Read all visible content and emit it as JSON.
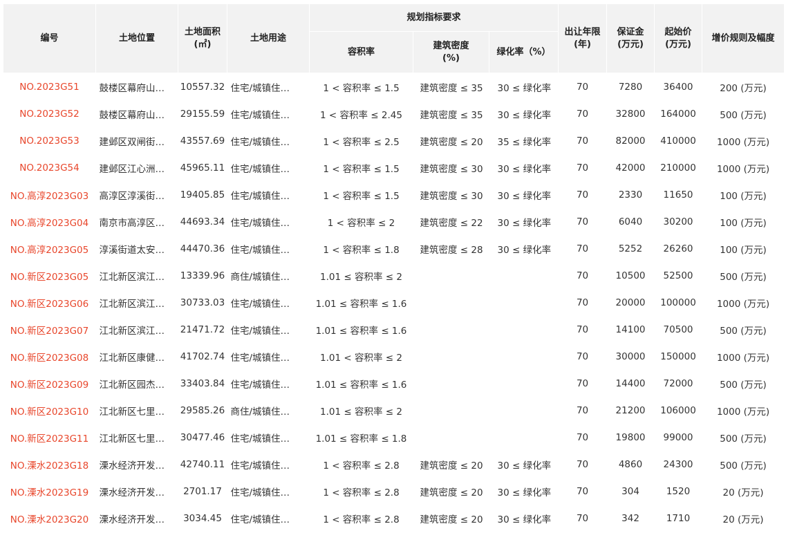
{
  "colors": {
    "code": "#e8462b",
    "header_bg": "#f2f2f2",
    "text": "#333333"
  },
  "headers": {
    "code": "编号",
    "location": "土地位置",
    "area": "土地面积\n(㎡)",
    "use": "土地用途",
    "planning": "规划指标要求",
    "far": "容积率",
    "density": "建筑密度\n(%)",
    "green": "绿化率（%）",
    "years": "出让年限\n(年)",
    "deposit": "保证金\n(万元)",
    "start": "起始价\n(万元)",
    "increment": "增价规则及幅度"
  },
  "rows": [
    {
      "code": "NO.2023G51",
      "location": "鼓楼区幕府山…",
      "area": "10557.32",
      "use": "住宅/城镇住…",
      "far": "1 < 容积率 ≤ 1.5",
      "density": "建筑密度 ≤ 35",
      "green": "30 ≤ 绿化率",
      "years": "70",
      "deposit": "7280",
      "start": "36400",
      "increment": "200 (万元)"
    },
    {
      "code": "NO.2023G52",
      "location": "鼓楼区幕府山…",
      "area": "29155.59",
      "use": "住宅/城镇住…",
      "far": "1 < 容积率 ≤ 2.45",
      "density": "建筑密度 ≤ 35",
      "green": "30 ≤ 绿化率",
      "years": "70",
      "deposit": "32800",
      "start": "164000",
      "increment": "500 (万元)"
    },
    {
      "code": "NO.2023G53",
      "location": "建邺区双闸街…",
      "area": "43557.69",
      "use": "住宅/城镇住…",
      "far": "1 < 容积率 ≤ 2.5",
      "density": "建筑密度 ≤ 20",
      "green": "35 ≤ 绿化率",
      "years": "70",
      "deposit": "82000",
      "start": "410000",
      "increment": "1000 (万元)"
    },
    {
      "code": "NO.2023G54",
      "location": "建邺区江心洲…",
      "area": "45965.11",
      "use": "住宅/城镇住…",
      "far": "1 < 容积率 ≤ 1.5",
      "density": "建筑密度 ≤ 30",
      "green": "30 ≤ 绿化率",
      "years": "70",
      "deposit": "42000",
      "start": "210000",
      "increment": "1000 (万元)"
    },
    {
      "code": "NO.高淳2023G03",
      "location": "高淳区淳溪街…",
      "area": "19405.85",
      "use": "住宅/城镇住…",
      "far": "1 < 容积率 ≤ 1.5",
      "density": "建筑密度 ≤ 30",
      "green": "30 ≤ 绿化率",
      "years": "70",
      "deposit": "2330",
      "start": "11650",
      "increment": "100 (万元)"
    },
    {
      "code": "NO.高淳2023G04",
      "location": "南京市高淳区…",
      "area": "44693.34",
      "use": "住宅/城镇住…",
      "far": "1 < 容积率 ≤ 2",
      "density": "建筑密度 ≤ 22",
      "green": "30 ≤ 绿化率",
      "years": "70",
      "deposit": "6040",
      "start": "30200",
      "increment": "100 (万元)"
    },
    {
      "code": "NO.高淳2023G05",
      "location": "淳溪街道太安…",
      "area": "44470.36",
      "use": "住宅/城镇住…",
      "far": "1 < 容积率 ≤ 1.8",
      "density": "建筑密度 ≤ 28",
      "green": "30 ≤ 绿化率",
      "years": "70",
      "deposit": "5252",
      "start": "26260",
      "increment": "100 (万元)"
    },
    {
      "code": "NO.新区2023G05",
      "location": "江北新区滨江…",
      "area": "13339.96",
      "use": "商住/城镇住…",
      "far": "1.01 ≤ 容积率 ≤ 2",
      "density": "",
      "green": "",
      "years": "70",
      "deposit": "10500",
      "start": "52500",
      "increment": "500 (万元)"
    },
    {
      "code": "NO.新区2023G06",
      "location": "江北新区滨江…",
      "area": "30733.03",
      "use": "住宅/城镇住…",
      "far": "1.01 ≤ 容积率 ≤ 1.6",
      "density": "",
      "green": "",
      "years": "70",
      "deposit": "20000",
      "start": "100000",
      "increment": "1000 (万元)"
    },
    {
      "code": "NO.新区2023G07",
      "location": "江北新区滨江…",
      "area": "21471.72",
      "use": "住宅/城镇住…",
      "far": "1.01 ≤ 容积率 ≤ 1.6",
      "density": "",
      "green": "",
      "years": "70",
      "deposit": "14100",
      "start": "70500",
      "increment": "500 (万元)"
    },
    {
      "code": "NO.新区2023G08",
      "location": "江北新区康健…",
      "area": "41702.74",
      "use": "住宅/城镇住…",
      "far": "1.01 < 容积率 ≤ 2",
      "density": "",
      "green": "",
      "years": "70",
      "deposit": "30000",
      "start": "150000",
      "increment": "1000 (万元)"
    },
    {
      "code": "NO.新区2023G09",
      "location": "江北新区园杰…",
      "area": "33403.84",
      "use": "住宅/城镇住…",
      "far": "1.01 ≤ 容积率 ≤ 1.6",
      "density": "",
      "green": "",
      "years": "70",
      "deposit": "14400",
      "start": "72000",
      "increment": "500 (万元)"
    },
    {
      "code": "NO.新区2023G10",
      "location": "江北新区七里…",
      "area": "29585.26",
      "use": "商住/城镇住…",
      "far": "1.01 ≤ 容积率 ≤ 2",
      "density": "",
      "green": "",
      "years": "70",
      "deposit": "21200",
      "start": "106000",
      "increment": "1000 (万元)"
    },
    {
      "code": "NO.新区2023G11",
      "location": "江北新区七里…",
      "area": "30477.46",
      "use": "住宅/城镇住…",
      "far": "1.01 ≤ 容积率 ≤ 1.8",
      "density": "",
      "green": "",
      "years": "70",
      "deposit": "19800",
      "start": "99000",
      "increment": "500 (万元)"
    },
    {
      "code": "NO.溧水2023G18",
      "location": "溧水经济开发…",
      "area": "42740.11",
      "use": "住宅/城镇住…",
      "far": "1 < 容积率 ≤ 2.8",
      "density": "建筑密度 ≤ 20",
      "green": "30 ≤ 绿化率",
      "years": "70",
      "deposit": "4860",
      "start": "24300",
      "increment": "500 (万元)"
    },
    {
      "code": "NO.溧水2023G19",
      "location": "溧水经济开发…",
      "area": "2701.17",
      "use": "住宅/城镇住…",
      "far": "1 < 容积率 ≤ 2.8",
      "density": "建筑密度 ≤ 20",
      "green": "30 ≤ 绿化率",
      "years": "70",
      "deposit": "304",
      "start": "1520",
      "increment": "20 (万元)"
    },
    {
      "code": "NO.溧水2023G20",
      "location": "溧水经济开发…",
      "area": "3034.45",
      "use": "住宅/城镇住…",
      "far": "1 < 容积率 ≤ 2.8",
      "density": "建筑密度 ≤ 20",
      "green": "30 ≤ 绿化率",
      "years": "70",
      "deposit": "342",
      "start": "1710",
      "increment": "20 (万元)"
    }
  ]
}
